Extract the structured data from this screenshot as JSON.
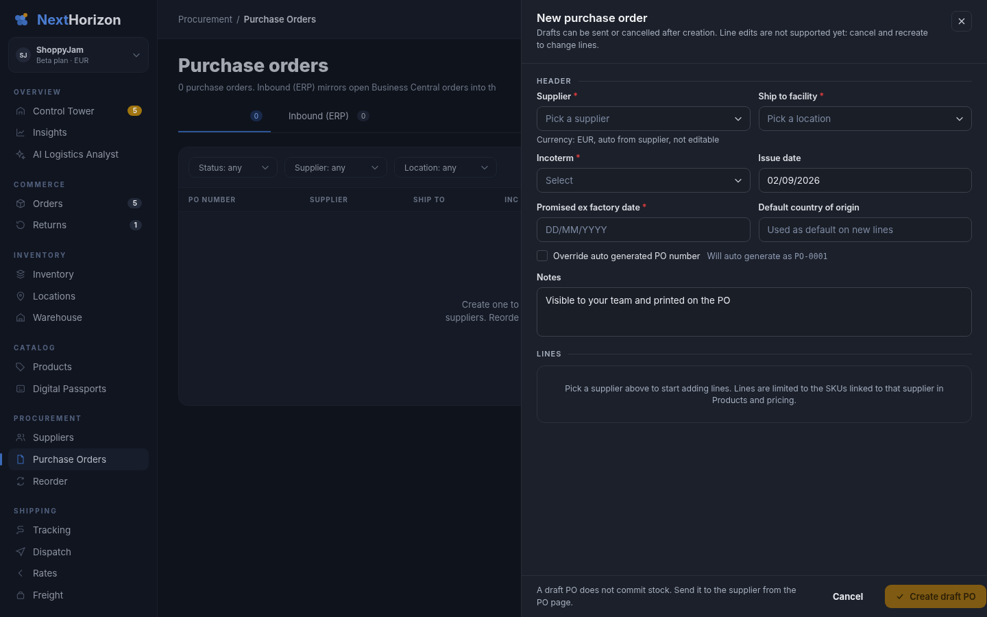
{
  "brand": {
    "name_part1": "Next",
    "name_part2": "Horizon"
  },
  "workspace": {
    "initials": "SJ",
    "name": "ShoppyJam",
    "plan": "Beta plan · EUR"
  },
  "sidebar": {
    "sections": [
      {
        "title": "OVERVIEW",
        "items": [
          {
            "label": "Control Tower",
            "selected": false,
            "badge": {
              "text": "5",
              "color": "#a0740f"
            }
          },
          {
            "label": "Insights",
            "selected": false
          },
          {
            "label": "AI Logistics Analyst",
            "selected": false
          }
        ]
      },
      {
        "title": "COMMERCE",
        "items": [
          {
            "label": "Orders",
            "selected": false,
            "badge": {
              "text": "5",
              "color": "#232a3a"
            }
          },
          {
            "label": "Returns",
            "selected": false,
            "badge": {
              "text": "1",
              "color": "#232a3a"
            }
          }
        ]
      },
      {
        "title": "INVENTORY",
        "items": [
          {
            "label": "Inventory",
            "selected": false
          },
          {
            "label": "Locations",
            "selected": false
          },
          {
            "label": "Warehouse",
            "selected": false
          }
        ]
      },
      {
        "title": "CATALOG",
        "items": [
          {
            "label": "Products",
            "selected": false
          },
          {
            "label": "Digital Passports",
            "selected": false
          }
        ]
      },
      {
        "title": "PROCUREMENT",
        "items": [
          {
            "label": "Suppliers",
            "selected": false
          },
          {
            "label": "Purchase Orders",
            "selected": true
          },
          {
            "label": "Reorder",
            "selected": false
          }
        ]
      },
      {
        "title": "SHIPPING",
        "items": [
          {
            "label": "Tracking",
            "selected": false
          },
          {
            "label": "Dispatch",
            "selected": false
          },
          {
            "label": "Rates",
            "selected": false
          },
          {
            "label": "Freight",
            "selected": false
          }
        ]
      }
    ]
  },
  "breadcrumb": {
    "separator": "/",
    "items": [
      "Procurement",
      "Purchase Orders"
    ]
  },
  "page": {
    "title": "Purchase orders",
    "subtitle": "0 purchase orders. Inbound (ERP) mirrors open Business Central orders into th"
  },
  "tabs": [
    {
      "count": "0",
      "selected": true
    },
    {
      "label": "Inbound (ERP)",
      "count": "0",
      "selected": false
    }
  ],
  "filters": [
    "Status: any",
    "Supplier: any",
    "Location: any"
  ],
  "table": {
    "columns": [
      "PO NUMBER",
      "SUPPLIER",
      "SHIP TO",
      "INC"
    ],
    "empty_lines": [
      "Create one to",
      "suppliers. Reorde"
    ]
  },
  "drawer": {
    "title": "New purchase order",
    "description": "Drafts can be sent or cancelled after creation. Line edits are not supported yet: cancel and recreate to change lines.",
    "header_section": "HEADER",
    "fields": [
      {
        "kind": "select",
        "label": "Supplier",
        "required_mark": "*",
        "placeholder": "Pick a supplier",
        "hint": "Currency: EUR, auto from supplier, not editable"
      },
      {
        "kind": "select",
        "label": "Ship to facility",
        "required_mark": "*",
        "placeholder": "Pick a location"
      },
      {
        "kind": "select",
        "label": "Incoterm",
        "required_mark": "*",
        "placeholder": "Select"
      },
      {
        "kind": "text",
        "label": "Issue date",
        "value": "02/09/2026"
      },
      {
        "kind": "text",
        "label": "Promised ex factory date",
        "required_mark": "*",
        "placeholder": "DD/MM/YYYY"
      },
      {
        "kind": "text",
        "label": "Default country of origin",
        "placeholder": "Used as default on new lines"
      }
    ],
    "override": {
      "label": "Override auto generated PO number",
      "checked": false,
      "note": "Will auto generate as",
      "code": "PO-0001"
    },
    "notes": {
      "label": "Notes",
      "value": "Visible to your team and printed on the PO"
    },
    "lines_section": "LINES",
    "lines_empty": "Pick a supplier above to start adding lines. Lines are limited to the SKUs linked to that supplier in Products and pricing.",
    "footer_note": "A draft PO does not commit stock. Send it to the supplier from the PO page.",
    "cancel": "Cancel",
    "submit": "Create draft PO"
  }
}
